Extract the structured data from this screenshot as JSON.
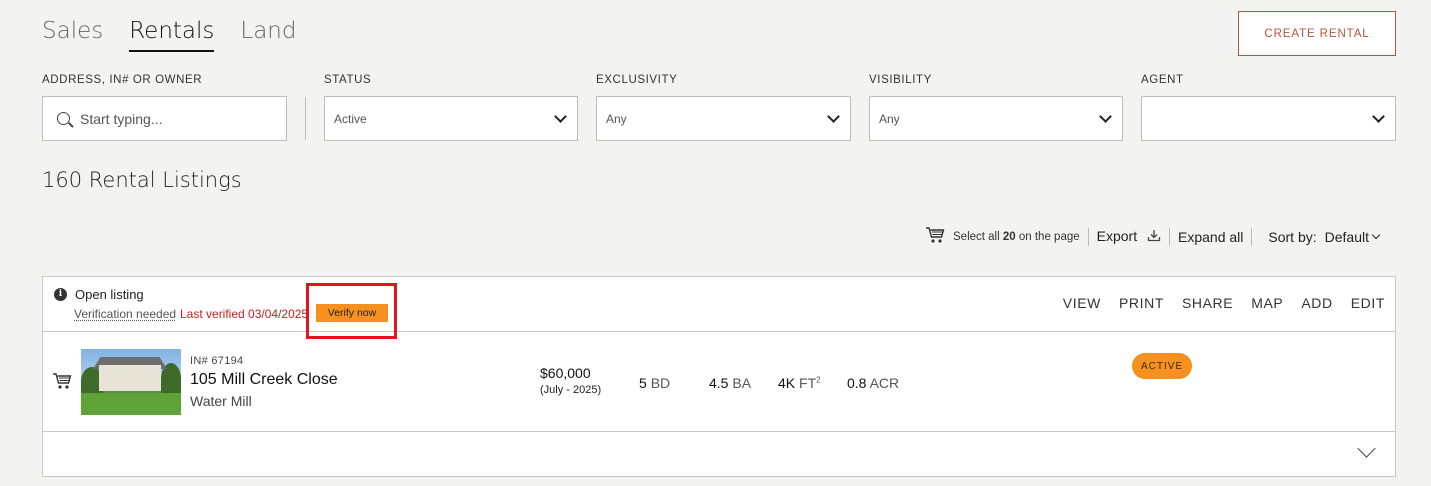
{
  "tabs": {
    "sales": "Sales",
    "rentals": "Rentals",
    "land": "Land"
  },
  "create_button": "CREATE RENTAL",
  "filters": {
    "address": {
      "label": "ADDRESS, IN# OR OWNER",
      "placeholder": "Start typing..."
    },
    "status": {
      "label": "STATUS",
      "value": "Active"
    },
    "exclusivity": {
      "label": "EXCLUSIVITY",
      "value": "Any"
    },
    "visibility": {
      "label": "VISIBILITY",
      "value": "Any"
    },
    "agent": {
      "label": "AGENT",
      "value": ""
    }
  },
  "listing_count": "160 Rental Listings",
  "toolbar": {
    "select_all_prefix": "Select all",
    "select_all_count": "20",
    "select_all_suffix": "on the page",
    "export": "Export",
    "expand_all": "Expand all",
    "sort_by_label": "Sort by:",
    "sort_by_value": "Default"
  },
  "card": {
    "open_listing": "Open listing",
    "verification_needed": "Verification needed",
    "last_verified": "Last verified 03/04/2025",
    "verify_now": "Verify now",
    "actions": [
      "VIEW",
      "PRINT",
      "SHARE",
      "MAP",
      "ADD",
      "EDIT"
    ],
    "listing": {
      "in_number": "IN# 67194",
      "address": "105 Mill Creek Close",
      "town": "Water Mill",
      "price": "$60,000",
      "period": "(July - 2025)",
      "beds_value": "5",
      "beds_unit": "BD",
      "baths_value": "4.5",
      "baths_unit": "BA",
      "sqft_value": "4K",
      "sqft_unit": "FT",
      "sqft_sup": "2",
      "acres_value": "0.8",
      "acres_unit": "ACR",
      "status_badge": "ACTIVE"
    }
  },
  "colors": {
    "accent": "#b5553c",
    "badge": "#f6901e",
    "warning_text": "#c62020",
    "highlight": "#e0161e"
  }
}
